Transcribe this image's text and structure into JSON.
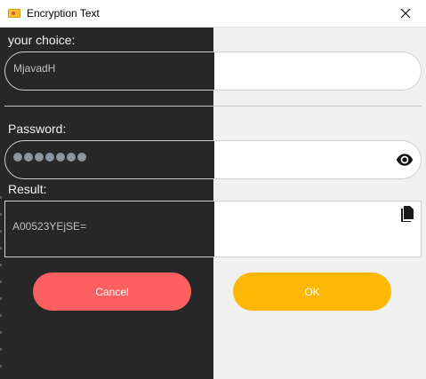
{
  "window": {
    "title": "Encryption Text",
    "icon": "envelope-icon"
  },
  "form": {
    "choice_label": "your choice:",
    "choice_value": "MjavadH",
    "password_label": "Password:",
    "password_mask_count": 7,
    "password_toggle_icon": "eye-icon",
    "result_label": "Result:",
    "result_value": "A00523YEjSE=",
    "copy_icon": "copy-icon"
  },
  "buttons": {
    "cancel_label": "Cancel",
    "ok_label": "OK"
  },
  "colors": {
    "dark_pane": "#272727",
    "cancel": "#fb5f5f",
    "ok": "#ffb705"
  }
}
